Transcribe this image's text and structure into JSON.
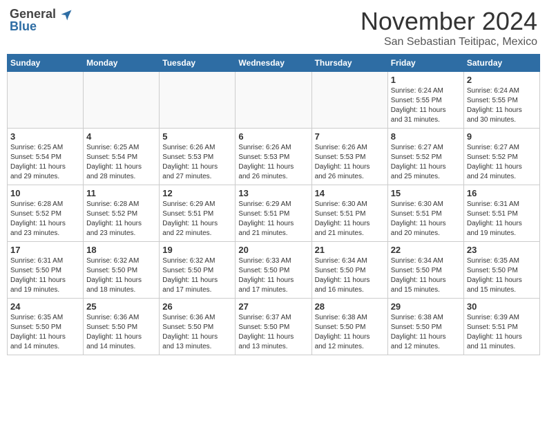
{
  "header": {
    "logo_general": "General",
    "logo_blue": "Blue",
    "month": "November 2024",
    "location": "San Sebastian Teitipac, Mexico"
  },
  "weekdays": [
    "Sunday",
    "Monday",
    "Tuesday",
    "Wednesday",
    "Thursday",
    "Friday",
    "Saturday"
  ],
  "weeks": [
    [
      {
        "day": "",
        "info": ""
      },
      {
        "day": "",
        "info": ""
      },
      {
        "day": "",
        "info": ""
      },
      {
        "day": "",
        "info": ""
      },
      {
        "day": "",
        "info": ""
      },
      {
        "day": "1",
        "info": "Sunrise: 6:24 AM\nSunset: 5:55 PM\nDaylight: 11 hours\nand 31 minutes."
      },
      {
        "day": "2",
        "info": "Sunrise: 6:24 AM\nSunset: 5:55 PM\nDaylight: 11 hours\nand 30 minutes."
      }
    ],
    [
      {
        "day": "3",
        "info": "Sunrise: 6:25 AM\nSunset: 5:54 PM\nDaylight: 11 hours\nand 29 minutes."
      },
      {
        "day": "4",
        "info": "Sunrise: 6:25 AM\nSunset: 5:54 PM\nDaylight: 11 hours\nand 28 minutes."
      },
      {
        "day": "5",
        "info": "Sunrise: 6:26 AM\nSunset: 5:53 PM\nDaylight: 11 hours\nand 27 minutes."
      },
      {
        "day": "6",
        "info": "Sunrise: 6:26 AM\nSunset: 5:53 PM\nDaylight: 11 hours\nand 26 minutes."
      },
      {
        "day": "7",
        "info": "Sunrise: 6:26 AM\nSunset: 5:53 PM\nDaylight: 11 hours\nand 26 minutes."
      },
      {
        "day": "8",
        "info": "Sunrise: 6:27 AM\nSunset: 5:52 PM\nDaylight: 11 hours\nand 25 minutes."
      },
      {
        "day": "9",
        "info": "Sunrise: 6:27 AM\nSunset: 5:52 PM\nDaylight: 11 hours\nand 24 minutes."
      }
    ],
    [
      {
        "day": "10",
        "info": "Sunrise: 6:28 AM\nSunset: 5:52 PM\nDaylight: 11 hours\nand 23 minutes."
      },
      {
        "day": "11",
        "info": "Sunrise: 6:28 AM\nSunset: 5:52 PM\nDaylight: 11 hours\nand 23 minutes."
      },
      {
        "day": "12",
        "info": "Sunrise: 6:29 AM\nSunset: 5:51 PM\nDaylight: 11 hours\nand 22 minutes."
      },
      {
        "day": "13",
        "info": "Sunrise: 6:29 AM\nSunset: 5:51 PM\nDaylight: 11 hours\nand 21 minutes."
      },
      {
        "day": "14",
        "info": "Sunrise: 6:30 AM\nSunset: 5:51 PM\nDaylight: 11 hours\nand 21 minutes."
      },
      {
        "day": "15",
        "info": "Sunrise: 6:30 AM\nSunset: 5:51 PM\nDaylight: 11 hours\nand 20 minutes."
      },
      {
        "day": "16",
        "info": "Sunrise: 6:31 AM\nSunset: 5:51 PM\nDaylight: 11 hours\nand 19 minutes."
      }
    ],
    [
      {
        "day": "17",
        "info": "Sunrise: 6:31 AM\nSunset: 5:50 PM\nDaylight: 11 hours\nand 19 minutes."
      },
      {
        "day": "18",
        "info": "Sunrise: 6:32 AM\nSunset: 5:50 PM\nDaylight: 11 hours\nand 18 minutes."
      },
      {
        "day": "19",
        "info": "Sunrise: 6:32 AM\nSunset: 5:50 PM\nDaylight: 11 hours\nand 17 minutes."
      },
      {
        "day": "20",
        "info": "Sunrise: 6:33 AM\nSunset: 5:50 PM\nDaylight: 11 hours\nand 17 minutes."
      },
      {
        "day": "21",
        "info": "Sunrise: 6:34 AM\nSunset: 5:50 PM\nDaylight: 11 hours\nand 16 minutes."
      },
      {
        "day": "22",
        "info": "Sunrise: 6:34 AM\nSunset: 5:50 PM\nDaylight: 11 hours\nand 15 minutes."
      },
      {
        "day": "23",
        "info": "Sunrise: 6:35 AM\nSunset: 5:50 PM\nDaylight: 11 hours\nand 15 minutes."
      }
    ],
    [
      {
        "day": "24",
        "info": "Sunrise: 6:35 AM\nSunset: 5:50 PM\nDaylight: 11 hours\nand 14 minutes."
      },
      {
        "day": "25",
        "info": "Sunrise: 6:36 AM\nSunset: 5:50 PM\nDaylight: 11 hours\nand 14 minutes."
      },
      {
        "day": "26",
        "info": "Sunrise: 6:36 AM\nSunset: 5:50 PM\nDaylight: 11 hours\nand 13 minutes."
      },
      {
        "day": "27",
        "info": "Sunrise: 6:37 AM\nSunset: 5:50 PM\nDaylight: 11 hours\nand 13 minutes."
      },
      {
        "day": "28",
        "info": "Sunrise: 6:38 AM\nSunset: 5:50 PM\nDaylight: 11 hours\nand 12 minutes."
      },
      {
        "day": "29",
        "info": "Sunrise: 6:38 AM\nSunset: 5:50 PM\nDaylight: 11 hours\nand 12 minutes."
      },
      {
        "day": "30",
        "info": "Sunrise: 6:39 AM\nSunset: 5:51 PM\nDaylight: 11 hours\nand 11 minutes."
      }
    ]
  ]
}
